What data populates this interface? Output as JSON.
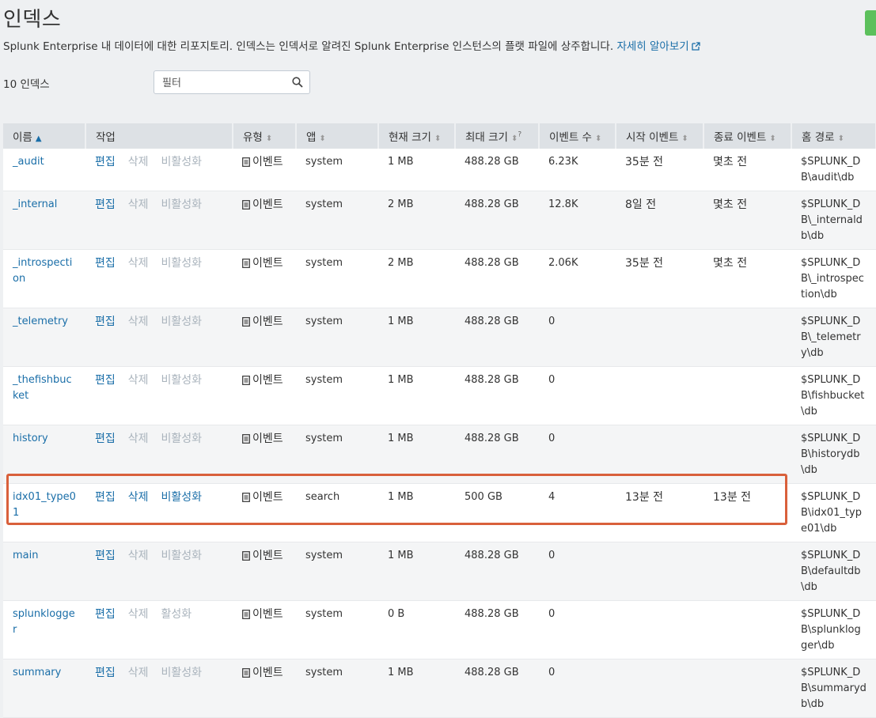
{
  "page": {
    "title": "인덱스",
    "description": "Splunk Enterprise 내 데이터에 대한 리포지토리. 인덱스는 인덱서로 알려진 Splunk Enterprise 인스턴스의 플랫 파일에 상주합니다.",
    "learn_more": "자세히 알아보기",
    "count_label": "10 인덱스"
  },
  "filter": {
    "placeholder": "필터"
  },
  "columns": [
    "이름",
    "작업",
    "유형",
    "앱",
    "현재 크기",
    "최대 크기",
    "이벤트 수",
    "시작 이벤트",
    "종료 이벤트",
    "홈 경로"
  ],
  "max_size_help": "?",
  "actions": {
    "edit": "편집",
    "delete": "삭제"
  },
  "highlight_color": "#d9603b",
  "rows": [
    {
      "name": "_audit",
      "toggle": "비활성화",
      "type": "이벤트",
      "app": "system",
      "current": "1 MB",
      "max": "488.28 GB",
      "events": "6.23K",
      "earliest": "35분 전",
      "latest": "몇초 전",
      "home": "$SPLUNK_DB\\audit\\db"
    },
    {
      "name": "_internal",
      "toggle": "비활성화",
      "type": "이벤트",
      "app": "system",
      "current": "2 MB",
      "max": "488.28 GB",
      "events": "12.8K",
      "earliest": "8일 전",
      "latest": "몇초 전",
      "home": "$SPLUNK_DB\\_internaldb\\db"
    },
    {
      "name": "_introspection",
      "toggle": "비활성화",
      "type": "이벤트",
      "app": "system",
      "current": "2 MB",
      "max": "488.28 GB",
      "events": "2.06K",
      "earliest": "35분 전",
      "latest": "몇초 전",
      "home": "$SPLUNK_DB\\_introspection\\db"
    },
    {
      "name": "_telemetry",
      "toggle": "비활성화",
      "type": "이벤트",
      "app": "system",
      "current": "1 MB",
      "max": "488.28 GB",
      "events": "0",
      "earliest": "",
      "latest": "",
      "home": "$SPLUNK_DB\\_telemetry\\db"
    },
    {
      "name": "_thefishbucket",
      "toggle": "비활성화",
      "type": "이벤트",
      "app": "system",
      "current": "1 MB",
      "max": "488.28 GB",
      "events": "0",
      "earliest": "",
      "latest": "",
      "home": "$SPLUNK_DB\\fishbucket\\db"
    },
    {
      "name": "history",
      "toggle": "비활성화",
      "type": "이벤트",
      "app": "system",
      "current": "1 MB",
      "max": "488.28 GB",
      "events": "0",
      "earliest": "",
      "latest": "",
      "home": "$SPLUNK_DB\\historydb\\db"
    },
    {
      "name": "idx01_type01",
      "toggle": "비활성화",
      "type": "이벤트",
      "app": "search",
      "current": "1 MB",
      "max": "500 GB",
      "events": "4",
      "earliest": "13분 전",
      "latest": "13분 전",
      "home": "$SPLUNK_DB\\idx01_type01\\db",
      "enabled_actions": true
    },
    {
      "name": "main",
      "toggle": "비활성화",
      "type": "이벤트",
      "app": "system",
      "current": "1 MB",
      "max": "488.28 GB",
      "events": "0",
      "earliest": "",
      "latest": "",
      "home": "$SPLUNK_DB\\defaultdb\\db"
    },
    {
      "name": "splunklogger",
      "toggle": "활성화",
      "type": "이벤트",
      "app": "system",
      "current": "0 B",
      "max": "488.28 GB",
      "events": "0",
      "earliest": "",
      "latest": "",
      "home": "$SPLUNK_DB\\splunklogger\\db"
    },
    {
      "name": "summary",
      "toggle": "비활성화",
      "type": "이벤트",
      "app": "system",
      "current": "1 MB",
      "max": "488.28 GB",
      "events": "0",
      "earliest": "",
      "latest": "",
      "home": "$SPLUNK_DB\\summarydb\\db"
    }
  ]
}
